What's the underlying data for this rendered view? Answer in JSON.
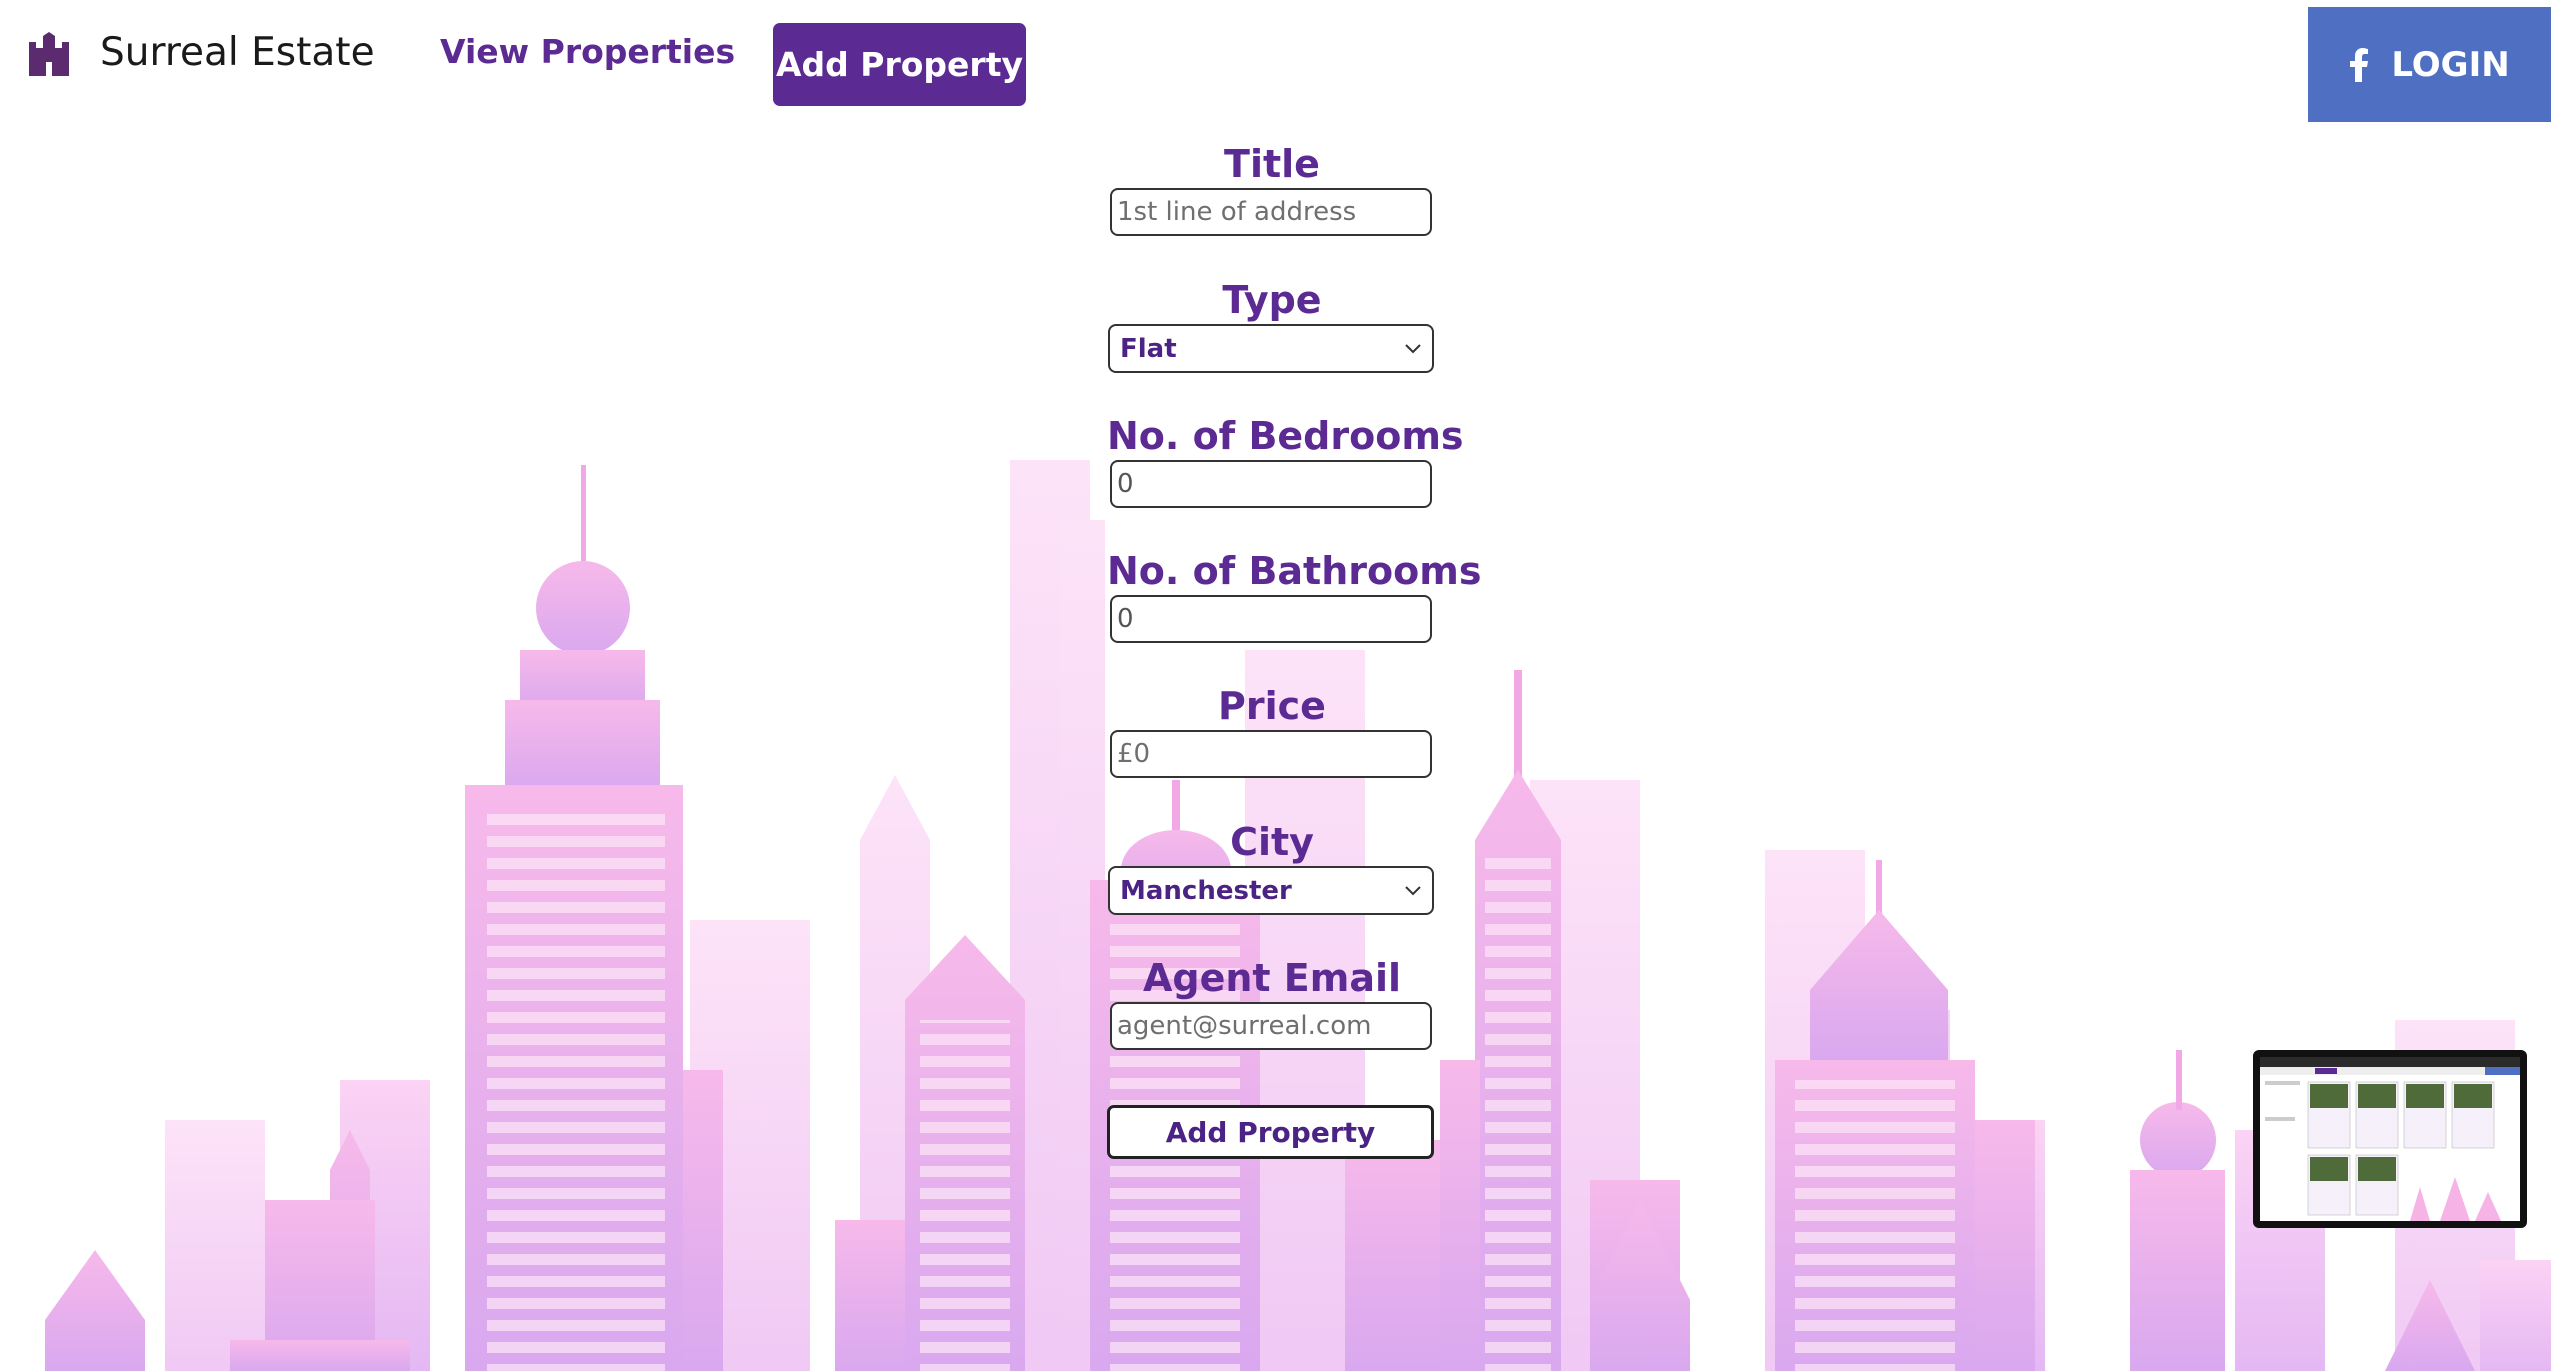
{
  "header": {
    "brand": "Surreal Estate",
    "nav_view": "View Properties",
    "nav_add": "Add Property",
    "login_label": "LOGIN",
    "logo_icon": "castle-icon",
    "login_icon": "facebook-icon"
  },
  "form": {
    "title_label": "Title",
    "title_placeholder": "1st line of address",
    "type_label": "Type",
    "type_value": "Flat",
    "bedrooms_label": "No. of Bedrooms",
    "bedrooms_value": "0",
    "bathrooms_label": "No. of Bathrooms",
    "bathrooms_value": "0",
    "price_label": "Price",
    "price_placeholder": "£0",
    "city_label": "City",
    "city_value": "Manchester",
    "email_label": "Agent Email",
    "email_placeholder": "agent@surreal.com",
    "submit_label": "Add Property"
  },
  "colors": {
    "accent": "#5b2a92",
    "login_bg": "#4e6fc2",
    "skyline_pink": "#f5b3e6",
    "skyline_violet": "#d6b4f0"
  }
}
